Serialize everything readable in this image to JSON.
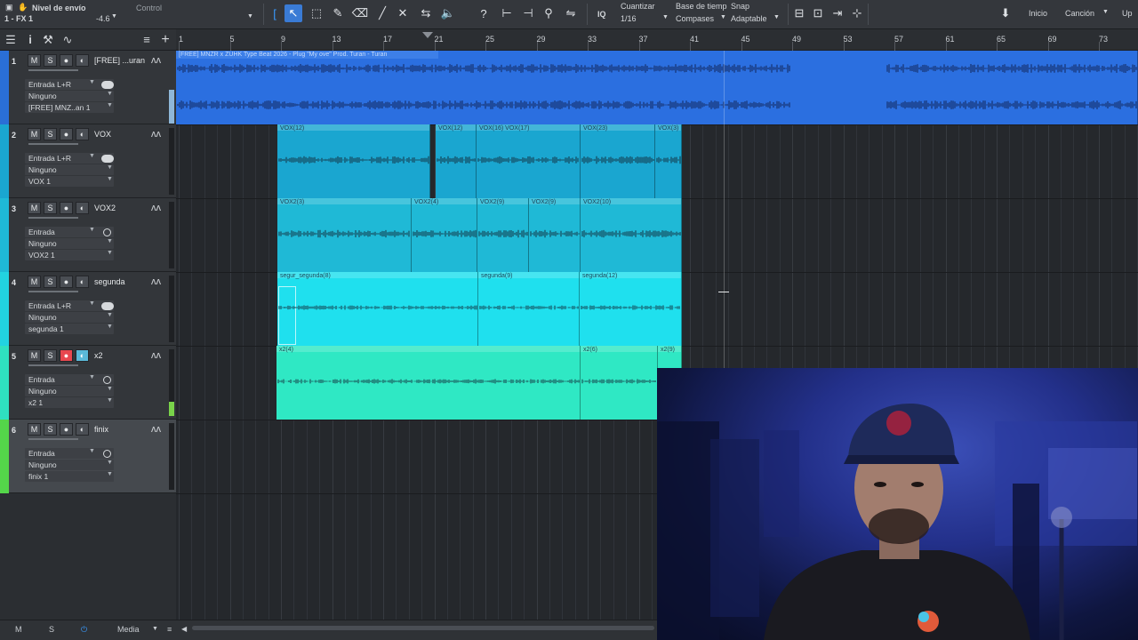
{
  "toolbar": {
    "send_level_label": "Nivel de envío",
    "control_label": "Control",
    "fx_label": "1 - FX 1",
    "send_value": "-4.6",
    "quantize_label": "Cuantizar",
    "quantize_value": "1/16",
    "timebase_label": "Base de tiemp",
    "timebase_value": "Compases",
    "snap_label": "Snap",
    "snap_value": "Adaptable",
    "iq_label": "IQ",
    "start_label": "Inicio",
    "song_label": "Canción",
    "up_label": "Up"
  },
  "ruler": {
    "bars": [
      "1",
      "5",
      "9",
      "13",
      "17",
      "21",
      "25",
      "29",
      "33",
      "37",
      "41",
      "45",
      "49",
      "53",
      "57",
      "61",
      "65",
      "69",
      "73"
    ]
  },
  "tracks": [
    {
      "num": "1",
      "name": "[FREE] ...uran",
      "input": "Entrada L+R",
      "output": "Ninguno",
      "channel": "[FREE] MNZ..an 1",
      "color": "#2a6fd6"
    },
    {
      "num": "2",
      "name": "VOX",
      "input": "Entrada L+R",
      "output": "Ninguno",
      "channel": "VOX 1",
      "color": "#1aa6d0"
    },
    {
      "num": "3",
      "name": "VOX2",
      "input": "Entrada",
      "output": "Ninguno",
      "channel": "VOX2 1",
      "color": "#1fb9d6"
    },
    {
      "num": "4",
      "name": "segunda",
      "input": "Entrada L+R",
      "output": "Ninguno",
      "channel": "segunda 1",
      "color": "#22d3e0"
    },
    {
      "num": "5",
      "name": "x2",
      "input": "Entrada",
      "output": "Ninguno",
      "channel": "x2 1",
      "color": "#2fe0c0"
    },
    {
      "num": "6",
      "name": "finix",
      "input": "Entrada",
      "output": "Ninguno",
      "channel": "finix 1",
      "color": "#54d64a"
    }
  ],
  "track_buttons": {
    "mute": "M",
    "solo": "S"
  },
  "clips": {
    "beat": "[FREE] MNZR x ZUHK Type Beat 2026 - Plug \"My ove\" Prod. Turan - Turan",
    "vox": [
      "VOX(12)",
      "VOX(12)",
      "VOX(16) VOX(17)",
      "VOX(23)",
      "VOX(3)"
    ],
    "vox2": [
      "VOX2(3)",
      "VOX2(4)",
      "VOX2(9)",
      "VOX2(9)",
      "VOX2(10)"
    ],
    "segunda": [
      "segur_segunda(8)",
      "segunda(9)",
      "segunda(12)"
    ],
    "x2": [
      "x2(4)",
      "x2(6)",
      "x2(9)"
    ]
  },
  "bottombar": {
    "m": "M",
    "s": "S",
    "media": "Media"
  },
  "colors": {
    "accent": "#3a7bd5",
    "record": "#e8474f",
    "monitor": "#5ab9d9"
  }
}
